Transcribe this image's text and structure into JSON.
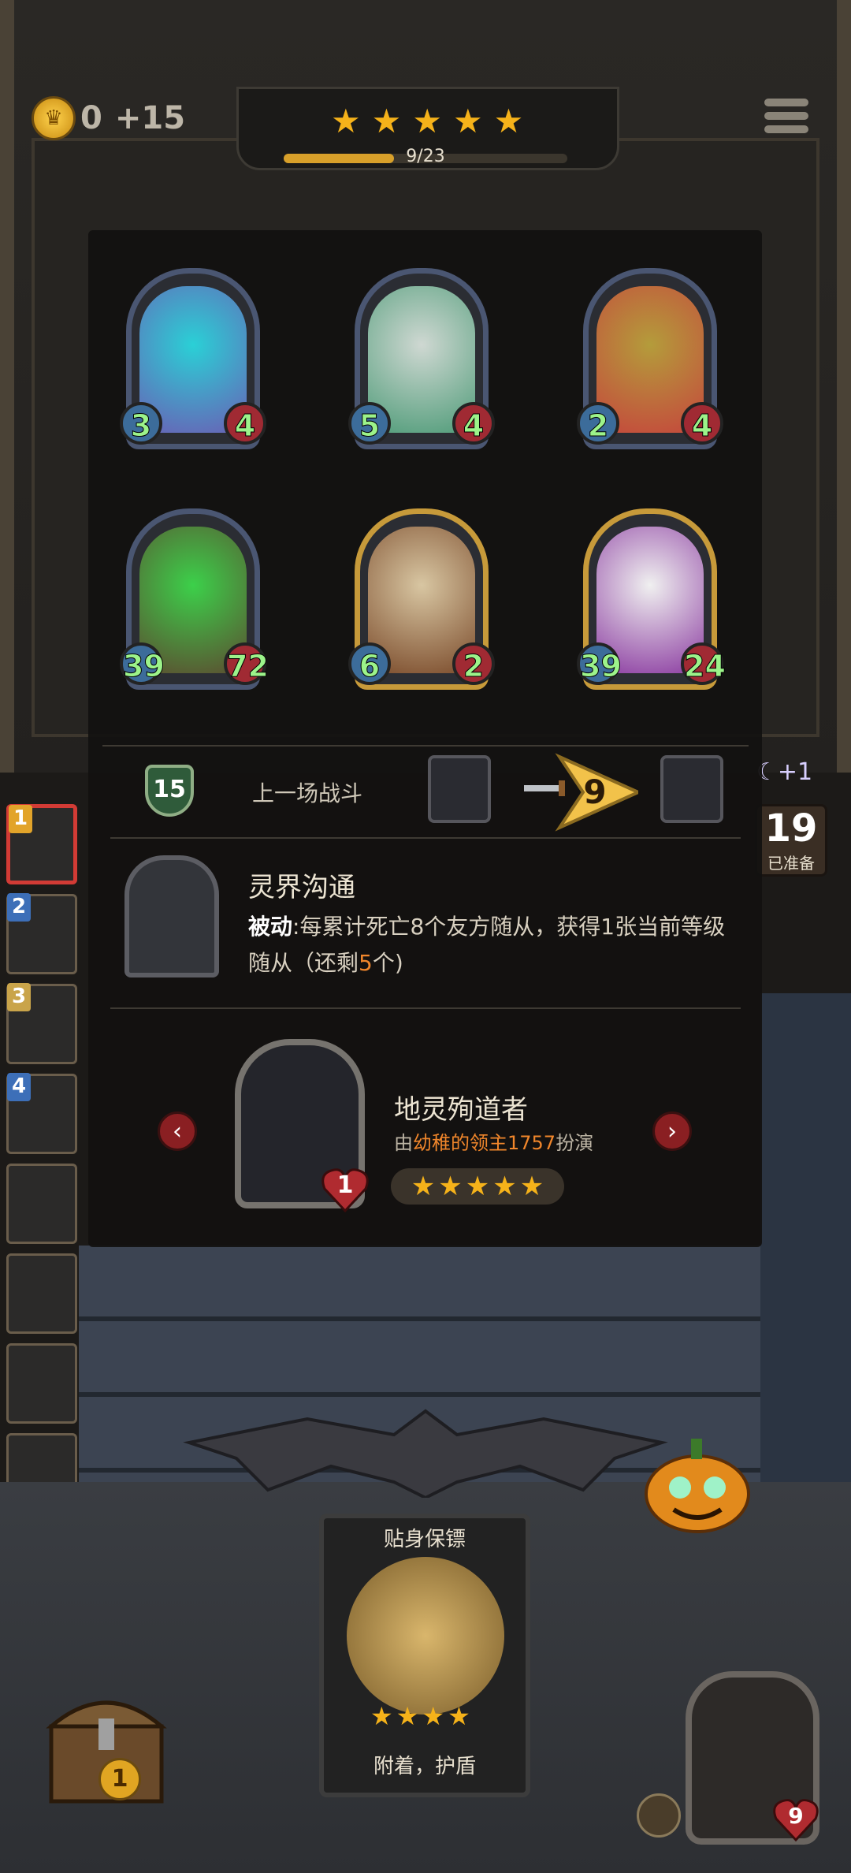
{
  "gold": {
    "amount": "0",
    "income": "+15"
  },
  "tier": {
    "stars": 5,
    "xp_text": "9/23",
    "xp_progress": 0.39
  },
  "shop_minions": [
    {
      "name": "",
      "attack": "3",
      "health": "4",
      "golden": false,
      "colors": [
        "#6a5fb5",
        "#2ad0d6"
      ]
    },
    {
      "name": "",
      "attack": "5",
      "health": "4",
      "golden": false,
      "colors": [
        "#4e9b78",
        "#cfd8d2"
      ]
    },
    {
      "name": "",
      "attack": "2",
      "health": "4",
      "golden": false,
      "colors": [
        "#c5463c",
        "#b49c3b"
      ]
    },
    {
      "name": "",
      "attack": "39",
      "health": "72",
      "golden": false,
      "colors": [
        "#5c4b30",
        "#3cd04a"
      ]
    },
    {
      "name": "",
      "attack": "6",
      "health": "2",
      "golden": true,
      "colors": [
        "#7a4a2a",
        "#d8c6a2"
      ]
    },
    {
      "name": "",
      "attack": "39",
      "health": "24",
      "golden": true,
      "colors": [
        "#8a3aa0",
        "#f0f0f0"
      ]
    }
  ],
  "battle": {
    "tier_level": "15",
    "last_battle_label": "上一场战斗",
    "damage": "9"
  },
  "ability": {
    "title": "灵界沟通",
    "keyword": "被动",
    "desc_part1": ":每累计死亡8个友方随从，获得1张当前等级随从（还剩",
    "remaining": "5",
    "desc_part2": "个)"
  },
  "player": {
    "name": "地灵殉道者",
    "sub_prefix": "由",
    "sub_player": "幼稚的领主1757",
    "sub_suffix": "扮演",
    "health": "1",
    "stars": 5
  },
  "side": {
    "bonus": "+1",
    "ready_count": "19",
    "ready_label": "已准备"
  },
  "warband_slots": [
    {
      "number": "1",
      "active": true,
      "num_color": "#e2a42a"
    },
    {
      "number": "2",
      "active": false,
      "num_color": "#3d6fb8"
    },
    {
      "number": "3",
      "active": false,
      "num_color": "#c9a44a"
    },
    {
      "number": "4",
      "active": false,
      "num_color": "#3d6fb8"
    },
    {
      "number": "",
      "active": false
    },
    {
      "number": "",
      "active": false
    },
    {
      "number": "",
      "active": false
    },
    {
      "number": "",
      "active": false
    }
  ],
  "bodyguard": {
    "title": "贴身保镖",
    "stars": 4,
    "desc": "附着，护盾"
  },
  "chest": {
    "count": "1"
  },
  "hero": {
    "health": "9"
  }
}
